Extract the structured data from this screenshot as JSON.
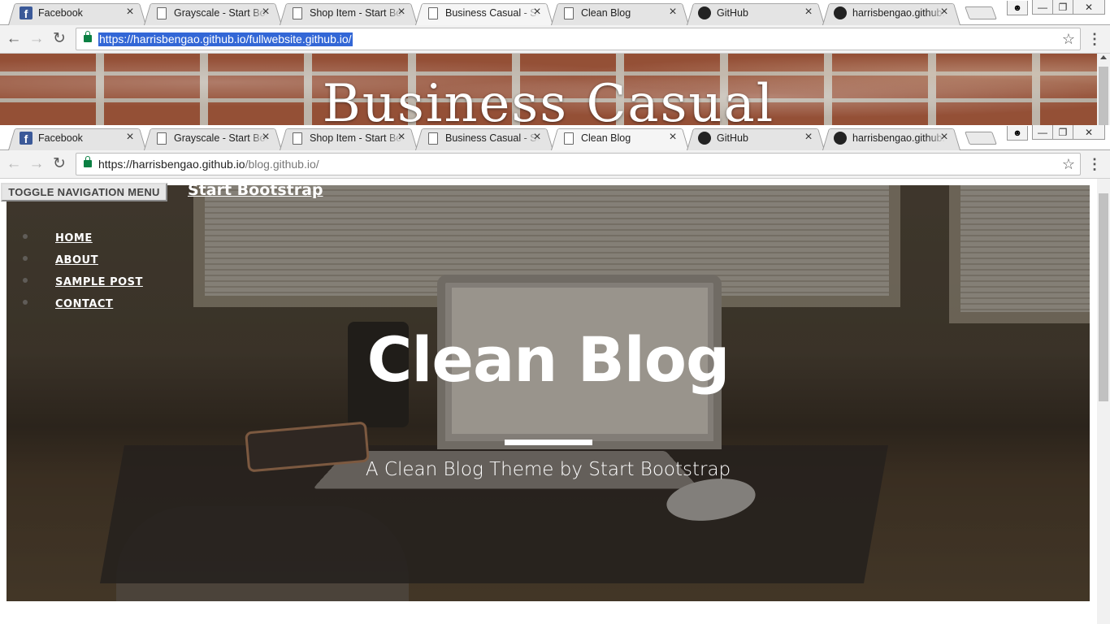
{
  "outer_browser": {
    "tabs": [
      {
        "title": "Facebook",
        "icon": "facebook-icon",
        "active": false
      },
      {
        "title": "Grayscale - Start Bootstrap",
        "icon": "page-icon",
        "active": false
      },
      {
        "title": "Shop Item - Start Bootstrap",
        "icon": "page-icon",
        "active": false
      },
      {
        "title": "Business Casual - Start Bootstrap",
        "icon": "page-icon",
        "active": true
      },
      {
        "title": "Clean Blog",
        "icon": "page-icon",
        "active": false
      },
      {
        "title": "GitHub",
        "icon": "github-icon",
        "active": false
      },
      {
        "title": "harrisbengao.github.io",
        "icon": "github-icon",
        "active": false
      }
    ],
    "url": "https://harrisbengao.github.io/fullwebsite.github.io/",
    "url_selected": true
  },
  "business_casual": {
    "title": "Business Casual"
  },
  "inner_browser": {
    "tabs": [
      {
        "title": "Facebook",
        "icon": "facebook-icon",
        "active": false
      },
      {
        "title": "Grayscale - Start Bootstrap",
        "icon": "page-icon",
        "active": false
      },
      {
        "title": "Shop Item - Start Bootstrap",
        "icon": "page-icon",
        "active": false
      },
      {
        "title": "Business Casual - Start Bootstrap",
        "icon": "page-icon",
        "active": false
      },
      {
        "title": "Clean Blog",
        "icon": "page-icon",
        "active": true
      },
      {
        "title": "GitHub",
        "icon": "github-icon",
        "active": false
      },
      {
        "title": "harrisbengao.github.io",
        "icon": "github-icon",
        "active": false
      }
    ],
    "url_host": "https://harrisbengao.github.io",
    "url_path": "/blog.github.io/"
  },
  "clean_blog": {
    "toggle_label": "TOGGLE NAVIGATION MENU",
    "brand": "Start Bootstrap",
    "nav": [
      "HOME",
      "ABOUT",
      "SAMPLE POST",
      "CONTACT"
    ],
    "title": "Clean Blog",
    "subtitle": "A Clean Blog Theme by Start Bootstrap"
  },
  "colors": {
    "lock_green": "#0b8043",
    "facebook_blue": "#3b5998",
    "selection_blue": "#3367d6"
  }
}
